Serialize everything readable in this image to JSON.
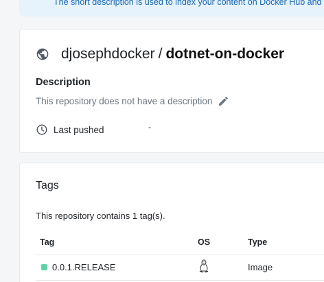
{
  "banner": {
    "text": "The short description is used to index your content on Docker Hub and in se"
  },
  "repo": {
    "visibility_icon": "globe-icon",
    "owner": "djosephdocker",
    "separator": "/",
    "name": "dotnet-on-docker",
    "description_heading": "Description",
    "description_text": "This repository does not have a description",
    "edit_icon": "pencil-icon",
    "last_pushed_label": "Last pushed",
    "last_pushed_value": "-",
    "last_pushed_icon": "clock-icon"
  },
  "tags": {
    "heading": "Tags",
    "count_text": "This repository contains 1 tag(s).",
    "columns": {
      "tag": "Tag",
      "os": "OS",
      "type": "Type"
    },
    "rows": [
      {
        "tag": "0.0.1.RELEASE",
        "os_icon": "linux-icon",
        "type": "Image",
        "status_color": "#5fd3a3"
      }
    ]
  }
}
